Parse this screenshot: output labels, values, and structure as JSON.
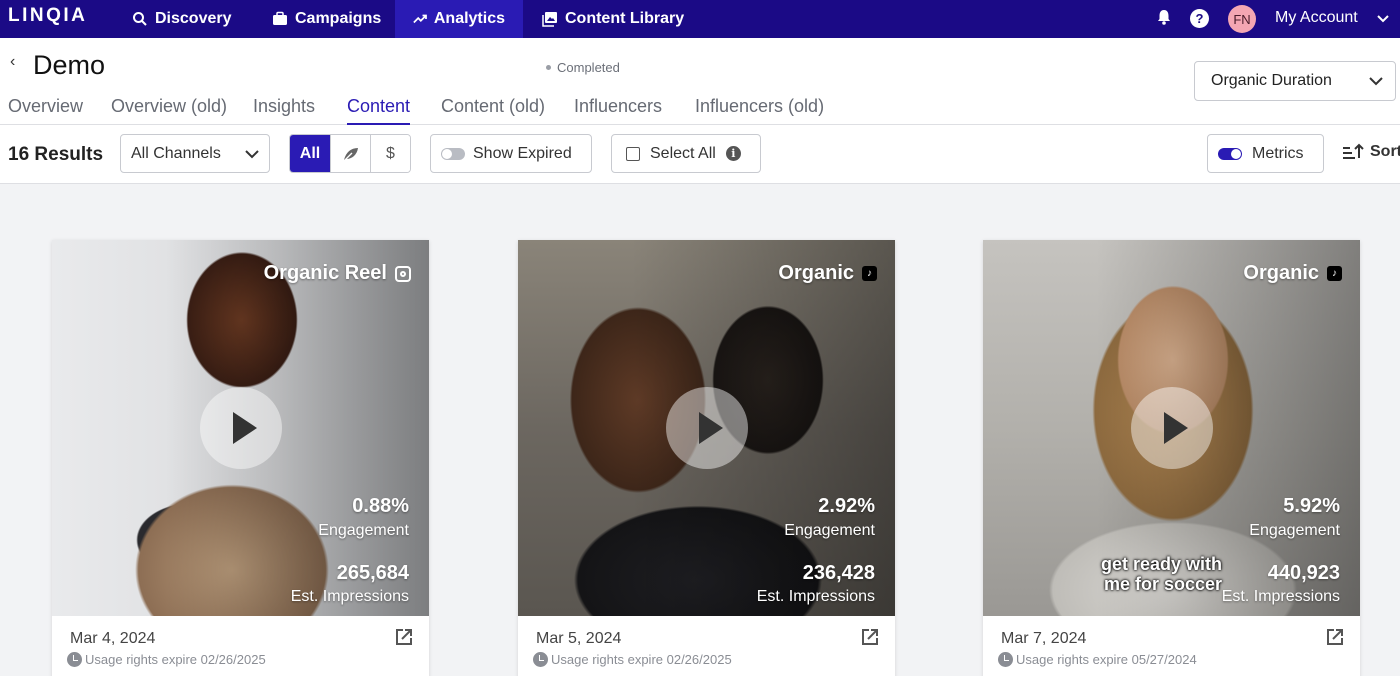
{
  "nav": {
    "logo": "LINQIA",
    "items": [
      {
        "label": "Discovery",
        "icon": "search-icon"
      },
      {
        "label": "Campaigns",
        "icon": "briefcase-icon"
      },
      {
        "label": "Analytics",
        "icon": "trending-up-icon",
        "active": true
      },
      {
        "label": "Content Library",
        "icon": "image-library-icon"
      }
    ],
    "avatar_initials": "FN",
    "account_label": "My Account",
    "colors": {
      "bar": "#1b0a86",
      "active": "#2a1bb4"
    }
  },
  "header": {
    "title": "Demo",
    "status": "Completed",
    "duration_select": "Organic Duration",
    "tabs": [
      "Overview",
      "Overview (old)",
      "Insights",
      "Content",
      "Content (old)",
      "Influencers",
      "Influencers (old)"
    ],
    "active_tab": "Content"
  },
  "toolbar": {
    "results": "16 Results",
    "channel_select": "All Channels",
    "filter_all": "All",
    "filter_organic_icon": "leaf-icon",
    "filter_paid_symbol": "$",
    "show_expired": "Show Expired",
    "select_all": "Select All",
    "info_symbol": "i",
    "metrics": "Metrics",
    "sort": "Sort"
  },
  "cards": [
    {
      "label": "Organic Reel",
      "platform": "instagram",
      "engagement_value": "0.88%",
      "engagement_label": "Engagement",
      "impressions_value": "265,684",
      "impressions_label": "Est. Impressions",
      "date": "Mar 4, 2024",
      "usage_rights": "Usage rights expire 02/26/2025"
    },
    {
      "label": "Organic",
      "platform": "tiktok",
      "engagement_value": "2.92%",
      "engagement_label": "Engagement",
      "impressions_value": "236,428",
      "impressions_label": "Est. Impressions",
      "date": "Mar 5, 2024",
      "usage_rights": "Usage rights expire 02/26/2025"
    },
    {
      "label": "Organic",
      "platform": "tiktok",
      "engagement_value": "5.92%",
      "engagement_label": "Engagement",
      "impressions_value": "440,923",
      "impressions_label": "Est. Impressions",
      "caption_overlay_line1": "get ready with",
      "caption_overlay_line2": "me for soccer",
      "date": "Mar 7, 2024",
      "usage_rights": "Usage rights expire 05/27/2024"
    }
  ]
}
